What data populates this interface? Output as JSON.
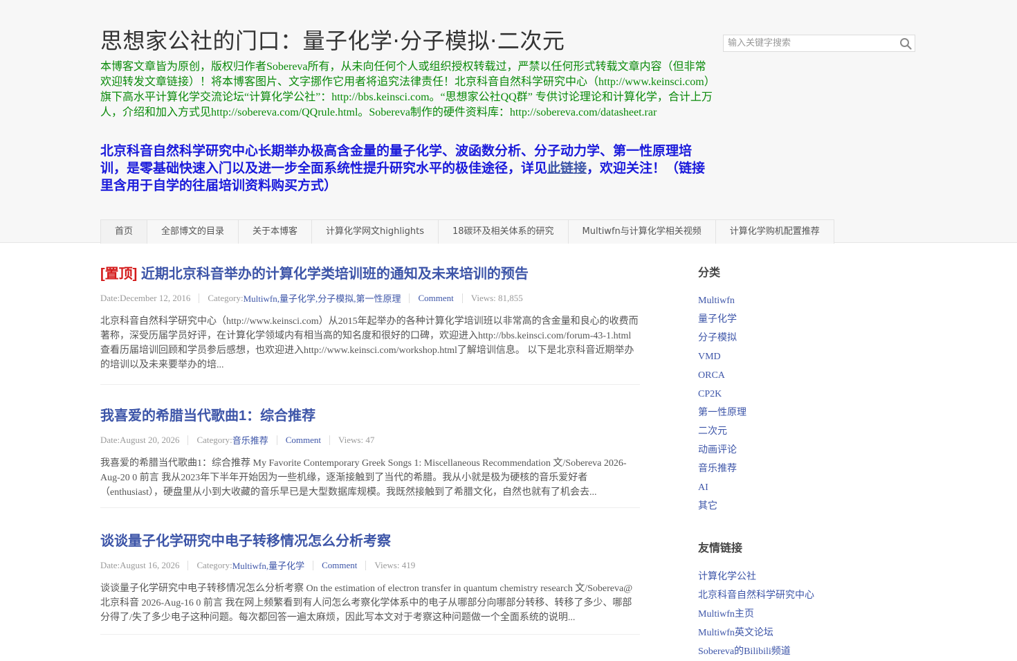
{
  "header": {
    "site_title": "思想家公社的门口：量子化学·分子模拟·二次元",
    "notice": "本博客文章皆为原创，版权归作者Sobereva所有，从未向任何个人或组织授权转载过，严禁以任何形式转载文章内容（但非常欢迎转发文章链接）！将本博客图片、文字挪作它用者将追究法律责任！北京科音自然科学研究中心（http://www.keinsci.com）旗下高水平计算化学交流论坛“计算化学公社”：http://bbs.keinsci.com。“思想家公社QQ群” 专供讨论理论和计算化学，合计上万人，介绍和加入方式见http://sobereva.com/QQrule.html。Sobereva制作的硬件资料库：http://sobereva.com/datasheet.rar",
    "promo_before": "北京科音自然科学研究中心长期举办极高含金量的量子化学、波函数分析、分子动力学、第一性原理培训，是零基础快速入门以及进一步全面系统性提升研究水平的极佳途径，详见",
    "promo_link": "此链接",
    "promo_after": "，欢迎关注！（链接里含用于自学的往届培训资料购买方式）"
  },
  "search": {
    "placeholder": "输入关键字搜索",
    "icon": "search-icon"
  },
  "nav": {
    "items": [
      "首页",
      "全部博文的目录",
      "关于本博客",
      "计算化学网文highlights",
      "18碳环及相关体系的研究",
      "Multiwfn与计算化学相关视频",
      "计算化学购机配置推荐"
    ]
  },
  "posts": [
    {
      "pin": "[置顶]",
      "title": "近期北京科音举办的计算化学类培训班的通知及未来培训的预告",
      "date_label": "Date: ",
      "date": "December 12, 2016",
      "category_label": "Category: ",
      "categories": "Multiwfn,量子化学,分子模拟,第一性原理",
      "comment": "Comment",
      "views": "Views: 81,855",
      "excerpt": "北京科音自然科学研究中心（http://www.keinsci.com）从2015年起举办的各种计算化学培训班以非常高的含金量和良心的收费而著称，深受历届学员好评，在计算化学领域内有相当高的知名度和很好的口碑，欢迎进入http://bbs.keinsci.com/forum-43-1.html查看历届培训回顾和学员参后感想，也欢迎进入http://www.keinsci.com/workshop.html了解培训信息。 以下是北京科音近期举办的培训以及未来要举办的培..."
    },
    {
      "pin": "",
      "title": "我喜爱的希腊当代歌曲1：综合推荐",
      "date_label": "Date: ",
      "date": "August 20, 2026",
      "category_label": "Category: ",
      "categories": "音乐推荐",
      "comment": "Comment",
      "views": "Views: 47",
      "excerpt": "我喜爱的希腊当代歌曲1：综合推荐 My Favorite Contemporary Greek Songs 1: Miscellaneous Recommendation 文/Sobereva  2026-Aug-20 0 前言 我从2023年下半年开始因为一些机缘，逐渐接触到了当代的希腊。我从小就是极为硬核的音乐爱好者（enthusiast），硬盘里从小到大收藏的音乐早已是大型数据库规模。我既然接触到了希腊文化，自然也就有了机会去..."
    },
    {
      "pin": "",
      "title": "谈谈量子化学研究中电子转移情况怎么分析考察",
      "date_label": "Date: ",
      "date": "August 16, 2026",
      "category_label": "Category: ",
      "categories": "Multiwfn,量子化学",
      "comment": "Comment",
      "views": "Views: 419",
      "excerpt": "谈谈量子化学研究中电子转移情况怎么分析考察 On the estimation of electron transfer in quantum chemistry research 文/Sobereva@北京科音  2026-Aug-16 0 前言 我在网上频繁看到有人问怎么考察化学体系中的电子从哪部分向哪部分转移、转移了多少、哪部分得了/失了多少电子这种问题。每次都回答一遍太麻烦，因此写本文对于考察这种问题做一个全面系统的说明..."
    }
  ],
  "sidebar": {
    "categories_title": "分类",
    "categories": [
      "Multiwfn",
      "量子化学",
      "分子模拟",
      "VMD",
      "ORCA",
      "CP2K",
      "第一性原理",
      "二次元",
      "动画评论",
      "音乐推荐",
      "AI",
      "其它"
    ],
    "links_title": "友情链接",
    "links": [
      "计算化学公社",
      "北京科音自然科学研究中心",
      "Multiwfn主页",
      "Multiwfn英文论坛",
      "Sobereva的Bilibili频道"
    ]
  }
}
